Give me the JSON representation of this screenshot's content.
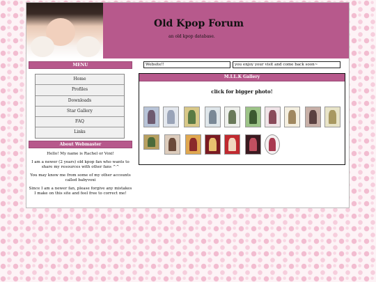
{
  "header": {
    "title": "Old Kpop Forum",
    "subtitle": "an old kpop database."
  },
  "menu": {
    "heading": "MENU",
    "items": [
      "Home",
      "Profiles",
      "Downloads",
      "Star Gallery",
      "FAQ",
      "Links"
    ]
  },
  "about": {
    "heading": "About Webmaster",
    "paragraphs": [
      "Hello! My name is Rachel or Voxi!",
      "I am a newer (2 years) old kpop fan who wants to share my resources with other fans ^^",
      "You may know me from some of my other accounts called babyvoxi",
      "Since I am a newer fan, please forgive any mistakes I make on this site and feel free to correct me!"
    ]
  },
  "marquees": [
    "Website!!",
    "you enjoy your visit and come back soon~"
  ],
  "gallery": {
    "heading": "M.I.L.K Gallery",
    "caption": "click for bigger photo!",
    "thumbnails": [
      {
        "icon": "photo-icon",
        "color": "#b8c4d8",
        "accent": "#6e5a70"
      },
      {
        "icon": "photo-icon",
        "color": "#e4e8ee",
        "accent": "#9aa4b8"
      },
      {
        "icon": "photo-icon",
        "color": "#d8c888",
        "accent": "#5a7a44"
      },
      {
        "icon": "photo-icon",
        "color": "#dfe6ea",
        "accent": "#7a8896"
      },
      {
        "icon": "photo-icon",
        "color": "#eef0ec",
        "accent": "#6a7a5a"
      },
      {
        "icon": "photo-icon",
        "color": "#9dc488",
        "accent": "#3c5a30"
      },
      {
        "icon": "photo-icon",
        "color": "#f0e4e8",
        "accent": "#8a4a5a"
      },
      {
        "icon": "photo-icon",
        "color": "#f4efe0",
        "accent": "#a08860"
      },
      {
        "icon": "photo-icon",
        "color": "#c8b0a8",
        "accent": "#5a4040"
      },
      {
        "icon": "photo-icon",
        "color": "#e8e4c8",
        "accent": "#a89860"
      },
      {
        "icon": "photo-icon",
        "color": "#b8a060",
        "accent": "#4a6a3a"
      },
      {
        "icon": "photo-icon",
        "color": "#dcccbc",
        "accent": "#6a4a3a"
      },
      {
        "icon": "photo-icon",
        "color": "#e0a850",
        "accent": "#8a2a2a"
      },
      {
        "icon": "photo-icon",
        "color": "#7a1a22",
        "accent": "#e8c070"
      },
      {
        "icon": "photo-icon",
        "color": "#c02a30",
        "accent": "#f0d8c0"
      },
      {
        "icon": "photo-icon",
        "color": "#3a1a20",
        "accent": "#c05060"
      },
      {
        "icon": "photo-icon",
        "color": "#f4f0f0",
        "accent": "#a83a50"
      }
    ]
  }
}
